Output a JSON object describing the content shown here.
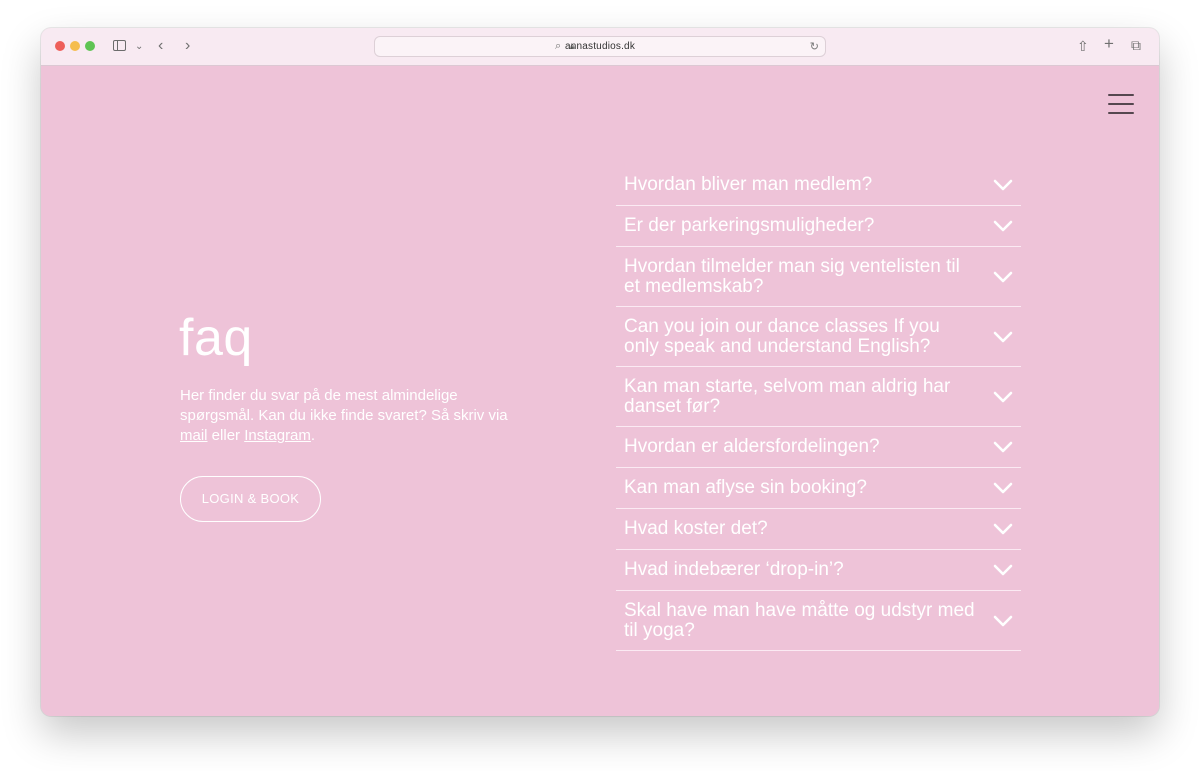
{
  "browser": {
    "url": "annastudios.dk"
  },
  "page": {
    "title": "faq",
    "intro_part1": "Her finder du svar på de mest almindelige spørgsmål. Kan du ikke finde svaret? Så skriv via ",
    "link_mail": "mail",
    "intro_part2": " eller ",
    "link_instagram": "Instagram",
    "intro_part3": ".",
    "login_button": "LOGIN & BOOK"
  },
  "faq": {
    "items": [
      {
        "q": "Hvordan bliver man medlem?"
      },
      {
        "q": "Er der parkeringsmuligheder?"
      },
      {
        "q": "Hvordan tilmelder man sig ventelisten til et medlemskab?"
      },
      {
        "q": "Can you join our dance classes If you only speak and understand English?"
      },
      {
        "q": "Kan man starte, selvom man aldrig har danset før?"
      },
      {
        "q": "Hvordan er aldersfordelingen?"
      },
      {
        "q": "Kan man aflyse sin booking?"
      },
      {
        "q": "Hvad koster det?"
      },
      {
        "q": "Hvad indebærer ‘drop-in’?"
      },
      {
        "q": "Skal have man have måtte og udstyr med til yoga?"
      }
    ]
  },
  "colors": {
    "page_bg": "#eec3d8",
    "toolbar_bg": "#f8eaf2",
    "text": "#ffffff"
  }
}
